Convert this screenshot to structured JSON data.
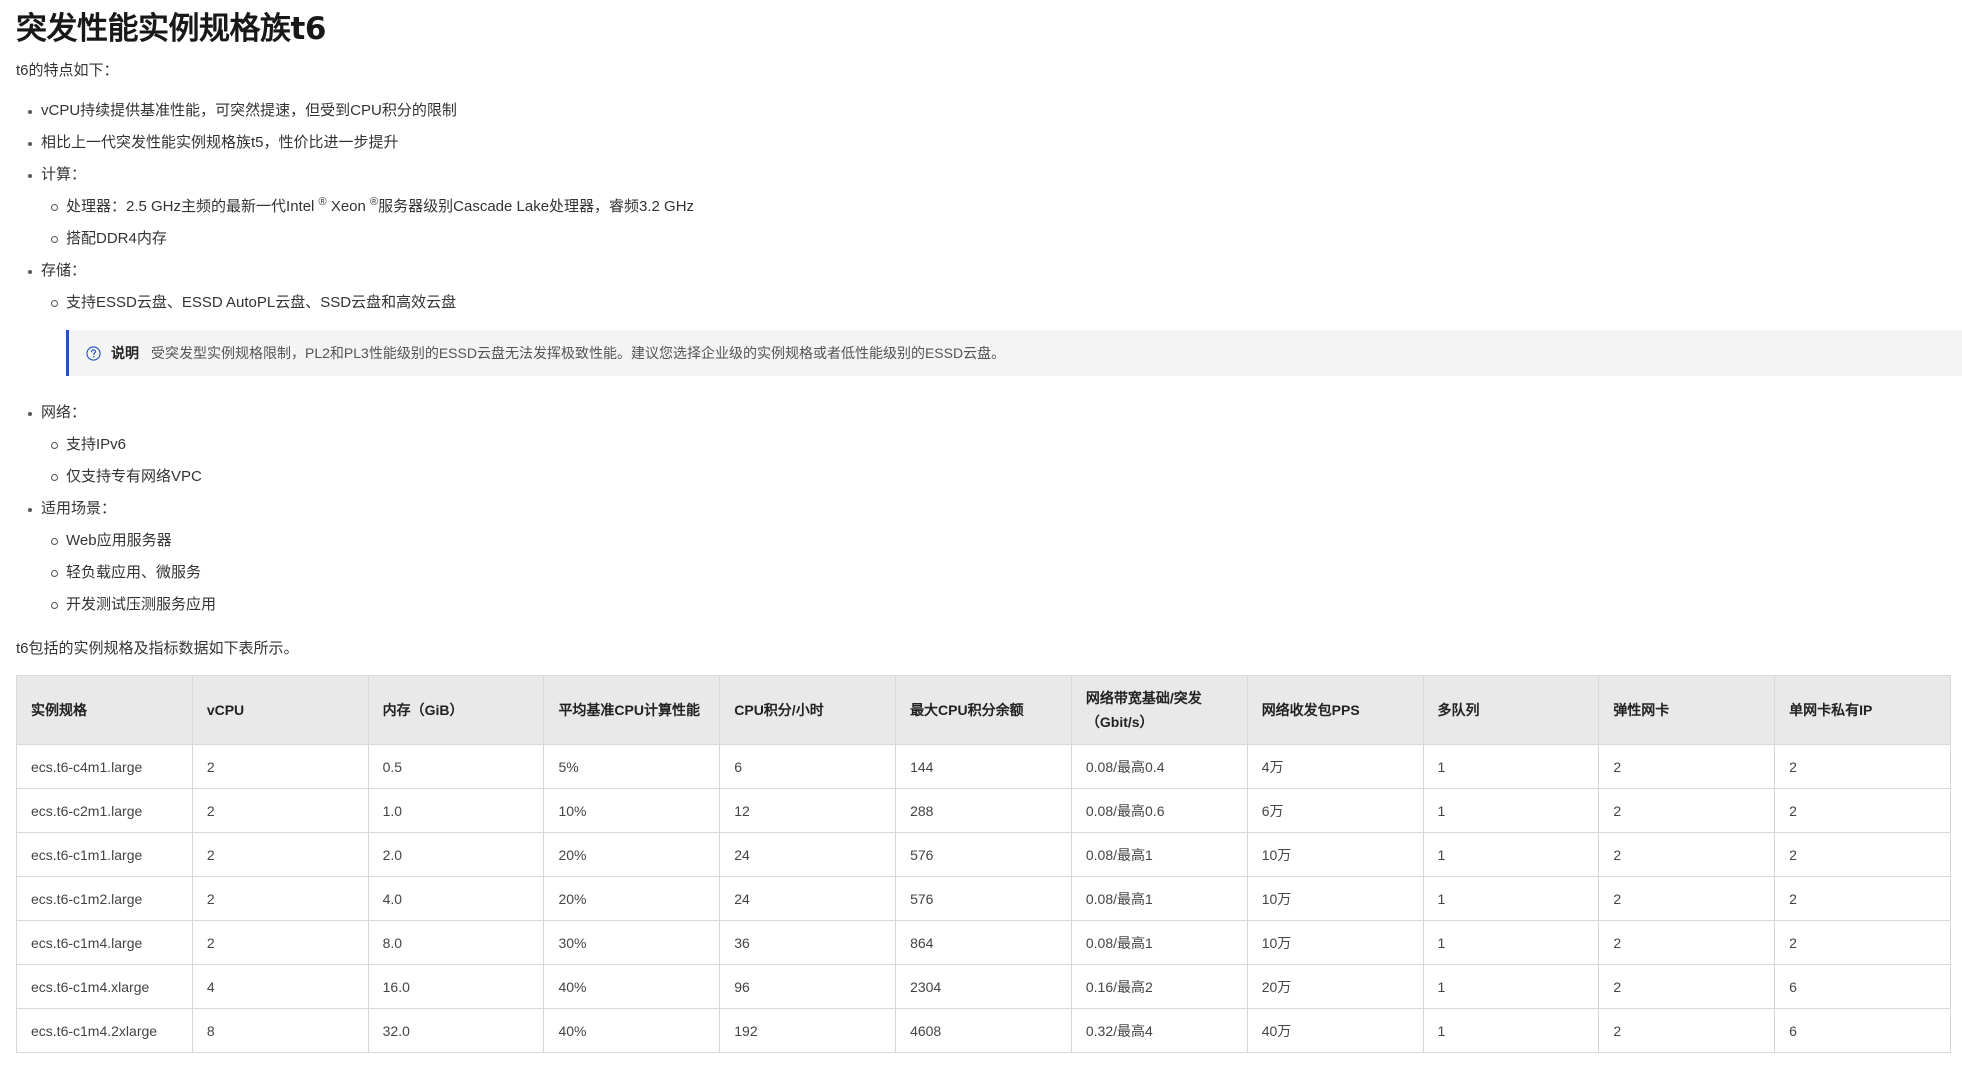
{
  "title": "突发性能实例规格族t6",
  "intro": "t6的特点如下：",
  "features": [
    {
      "text": "vCPU持续提供基准性能，可突然提速，但受到CPU积分的限制",
      "sub": []
    },
    {
      "text": "相比上一代突发性能实例规格族t5，性价比进一步提升",
      "sub": []
    },
    {
      "text": "计算：",
      "sub": [
        {
          "pre": "处理器：2.5 GHz主频的最新一代Intel ",
          "sup1": "®",
          "mid": " Xeon ",
          "sup2": "®",
          "post": "服务器级别Cascade Lake处理器，睿频3.2 GHz"
        },
        {
          "text": "搭配DDR4内存"
        }
      ]
    },
    {
      "text": "存储：",
      "sub": [
        {
          "text": "支持ESSD云盘、ESSD AutoPL云盘、SSD云盘和高效云盘"
        }
      ]
    },
    {
      "text": "网络：",
      "sub": [
        {
          "text": "支持IPv6"
        },
        {
          "text": "仅支持专有网络VPC"
        }
      ]
    },
    {
      "text": "适用场景：",
      "sub": [
        {
          "text": "Web应用服务器"
        },
        {
          "text": "轻负载应用、微服务"
        },
        {
          "text": "开发测试压测服务应用"
        }
      ]
    }
  ],
  "note": {
    "icon": "question-circle-icon",
    "title": "说明",
    "text": "受突发型实例规格限制，PL2和PL3性能级别的ESSD云盘无法发挥极致性能。建议您选择企业级的实例规格或者低性能级别的ESSD云盘。",
    "accent": "#1f54b6"
  },
  "outro": "t6包括的实例规格及指标数据如下表所示。",
  "table": {
    "headers": [
      "实例规格",
      "vCPU",
      "内存（GiB）",
      "平均基准CPU计算性能",
      "CPU积分/小时",
      "最大CPU积分余额",
      "网络带宽基础/突发（Gbit/s）",
      "网络收发包PPS",
      "多队列",
      "弹性网卡",
      "单网卡私有IP"
    ],
    "rows": [
      [
        "ecs.t6-c4m1.large",
        "2",
        "0.5",
        "5%",
        "6",
        "144",
        "0.08/最高0.4",
        "4万",
        "1",
        "2",
        "2"
      ],
      [
        "ecs.t6-c2m1.large",
        "2",
        "1.0",
        "10%",
        "12",
        "288",
        "0.08/最高0.6",
        "6万",
        "1",
        "2",
        "2"
      ],
      [
        "ecs.t6-c1m1.large",
        "2",
        "2.0",
        "20%",
        "24",
        "576",
        "0.08/最高1",
        "10万",
        "1",
        "2",
        "2"
      ],
      [
        "ecs.t6-c1m2.large",
        "2",
        "4.0",
        "20%",
        "24",
        "576",
        "0.08/最高1",
        "10万",
        "1",
        "2",
        "2"
      ],
      [
        "ecs.t6-c1m4.large",
        "2",
        "8.0",
        "30%",
        "36",
        "864",
        "0.08/最高1",
        "10万",
        "1",
        "2",
        "2"
      ],
      [
        "ecs.t6-c1m4.xlarge",
        "4",
        "16.0",
        "40%",
        "96",
        "2304",
        "0.16/最高2",
        "20万",
        "1",
        "2",
        "6"
      ],
      [
        "ecs.t6-c1m4.2xlarge",
        "8",
        "32.0",
        "40%",
        "192",
        "4608",
        "0.32/最高4",
        "40万",
        "1",
        "2",
        "6"
      ]
    ]
  }
}
